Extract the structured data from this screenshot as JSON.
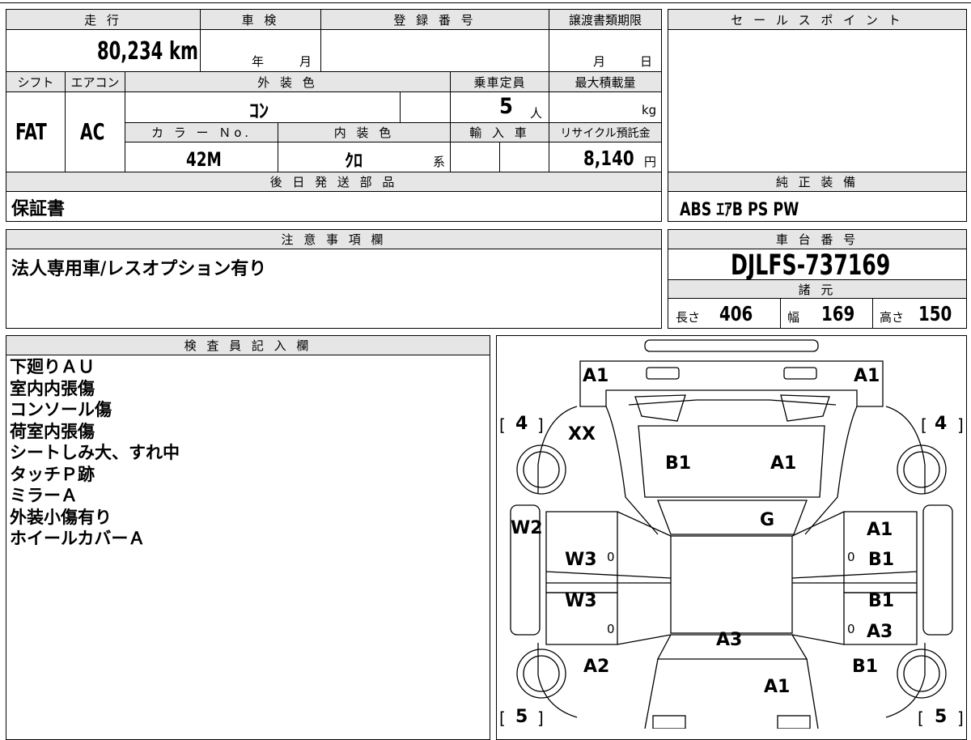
{
  "mileage": {
    "label": "走 行",
    "value": "80,234",
    "unit": "km"
  },
  "shaken": {
    "label": "車 検",
    "year_unit": "年",
    "month_unit": "月"
  },
  "registration": {
    "label": "登 録 番 号",
    "value": ""
  },
  "transfer_deadline": {
    "label": "譲渡書類期限",
    "month_unit": "月",
    "day_unit": "日"
  },
  "sales_point": {
    "label": "セ ー ル ス ポ イ ン ト",
    "value": ""
  },
  "shift": {
    "label": "シフト",
    "value": "FAT"
  },
  "aircon": {
    "label": "エアコン",
    "value": "AC"
  },
  "exterior_color": {
    "label": "外 装 色",
    "value": "ｺﾝ"
  },
  "capacity": {
    "label": "乗車定員",
    "value": "5",
    "unit": "人"
  },
  "max_load": {
    "label": "最大積載量",
    "value": "",
    "unit": "kg"
  },
  "color_no": {
    "label": "カ ラ ー Ｎo.",
    "value": "42M"
  },
  "interior_color": {
    "label": "内 装 色",
    "value": "ｸﾛ",
    "unit": "系"
  },
  "import": {
    "label": "輸 入 車",
    "value": ""
  },
  "recycle": {
    "label": "リサイクル預託金",
    "value": "8,140",
    "unit": "円"
  },
  "later_parts": {
    "label": "後 日 発 送 部 品",
    "value": "保証書"
  },
  "genuine_equipment": {
    "label": "純 正 装 備",
    "value": "ABS ｴｱB PS PW"
  },
  "caution": {
    "label": "注 意 事 項 欄",
    "value": "法人専用車/レスオプション有り"
  },
  "chassis": {
    "label": "車 台 番 号",
    "value": "DJLFS-737169"
  },
  "specs": {
    "label": "諸 元",
    "length_label": "長さ",
    "length": "406",
    "width_label": "幅",
    "width": "169",
    "height_label": "高さ",
    "height": "150"
  },
  "inspector": {
    "label": "検 査 員 記 入 欄",
    "lines": [
      "下廻りＡＵ",
      "室内内張傷",
      "コンソール傷",
      "荷室内張傷",
      "シートしみ大、すれ中",
      "タッチＰ跡",
      "ミラーＡ",
      "外装小傷有り",
      "ホイールカバーＡ"
    ]
  },
  "diagram": {
    "a1_top_left": "A1",
    "a1_top_right": "A1",
    "tire_fl_left": "[",
    "tire_fl": "4",
    "tire_fl_right": "]",
    "tire_fr_left": "[",
    "tire_fr": "4",
    "tire_fr_right": "]",
    "tire_rl_left": "[",
    "tire_rl": "5",
    "tire_rl_right": "]",
    "tire_rr_left": "[",
    "tire_rr": "5",
    "tire_rr_right": "]",
    "xx": "XX",
    "b1_hood": "B1",
    "a1_hood": "A1",
    "g_windshield": "G",
    "w2": "W2",
    "w3_front_left": "W3",
    "w3_rear_left": "W3",
    "a1_front_right_door": "A1",
    "b1_front_right_door": "B1",
    "b1_rear_right_door": "B1",
    "a3_rear_right_door": "A3",
    "a3_roof": "A3",
    "a2_rear_left": "A2",
    "b1_rear_right": "B1",
    "a1_rear": "A1",
    "zero_1": "0",
    "zero_2": "0",
    "zero_3": "0",
    "zero_4": "0"
  }
}
